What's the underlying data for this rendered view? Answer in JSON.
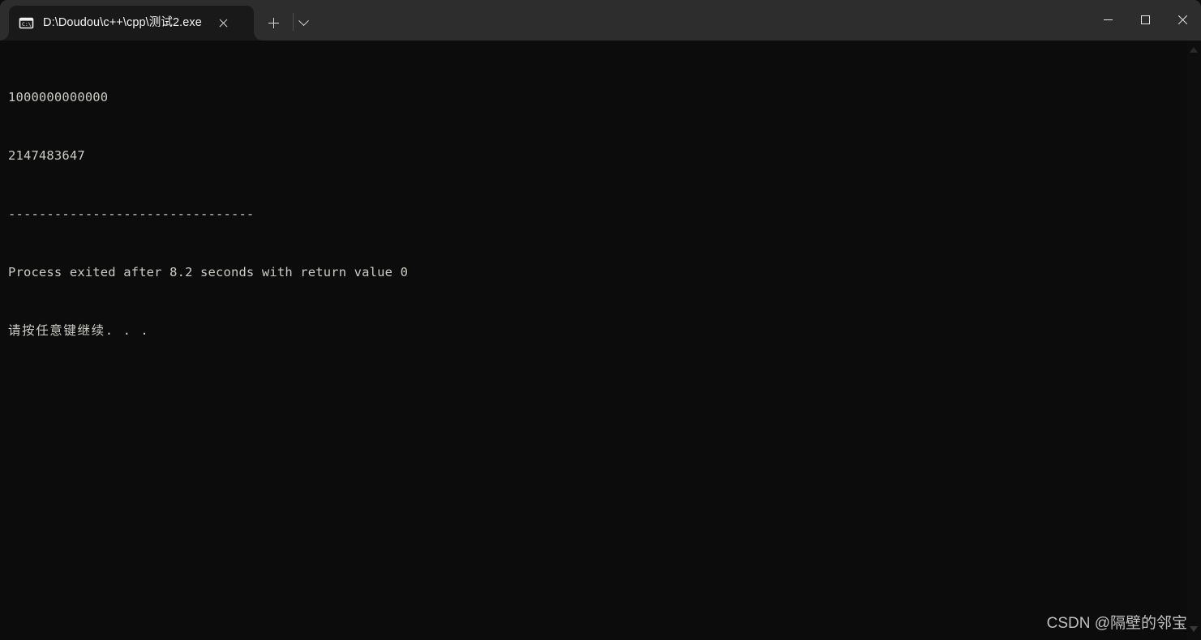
{
  "window": {
    "titlebar_color": "#2d2d2d",
    "tab_color": "#191919",
    "console_bg": "#0c0c0c",
    "console_fg": "#ccccc6"
  },
  "tab": {
    "icon": "cmd-console-icon",
    "icon_label": "C:\\",
    "title": "D:\\Doudou\\c++\\cpp\\测试2.exe",
    "close_icon": "close-icon"
  },
  "tabstrip": {
    "new_tab_icon": "plus-icon",
    "tab_list_icon": "chevron-down-icon"
  },
  "caption": {
    "minimize_icon": "minimize-icon",
    "maximize_icon": "maximize-icon",
    "close_icon": "close-icon"
  },
  "console": {
    "lines": [
      "1000000000000",
      "2147483647",
      "--------------------------------",
      "Process exited after 8.2 seconds with return value 0",
      "请按任意键继续. . ."
    ],
    "line1_value": "1000000000000",
    "line2_value": "2147483647",
    "separator": "--------------------------------",
    "exit_message": "Process exited after 8.2 seconds with return value 0",
    "exit_seconds": "8.2",
    "exit_return_value": "0",
    "prompt": "请按任意键继续. . .",
    "text_block": "1000000000000\n2147483647\n--------------------------------\nProcess exited after 8.2 seconds with return value 0"
  },
  "scrollbar": {
    "up_icon": "caret-up-icon",
    "down_icon": "caret-down-icon"
  },
  "watermark": {
    "text": "CSDN @隔壁的邻宝"
  }
}
